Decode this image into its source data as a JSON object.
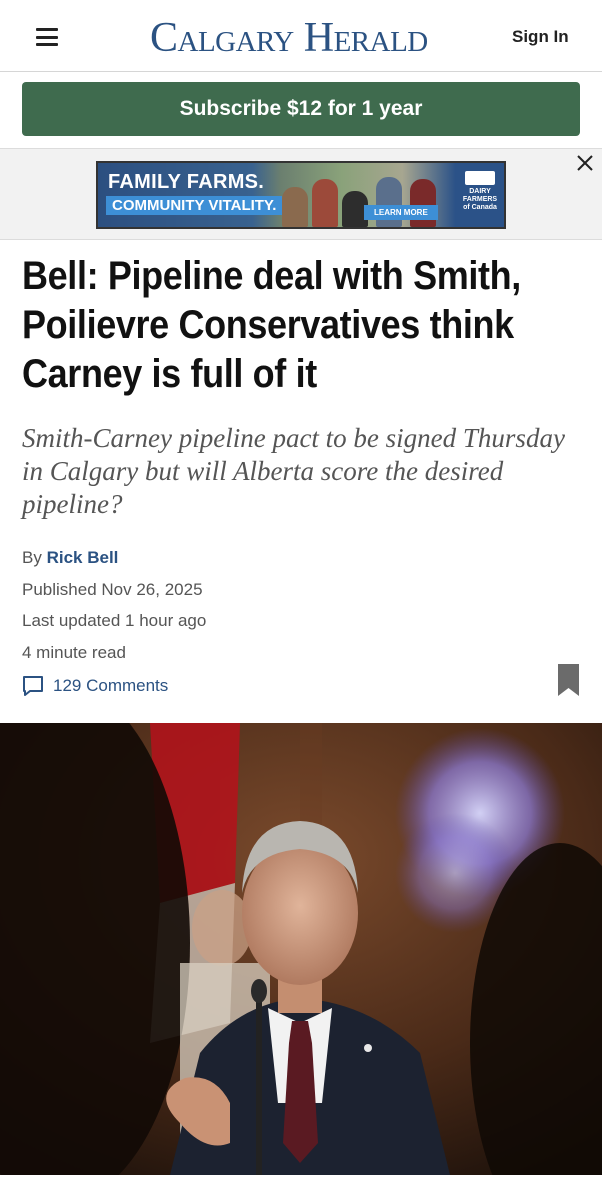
{
  "header": {
    "logo": "Calgary Herald",
    "sign_in": "Sign In",
    "menu_icon": "hamburger-menu-icon"
  },
  "subscribe": {
    "label": "Subscribe $12 for 1 year",
    "color": "#3f6b4e"
  },
  "ad": {
    "line1": "FAMILY FARMS.",
    "line2": "COMMUNITY VITALITY.",
    "cta": "LEARN MORE",
    "logo_text": "DAIRY FARMERS of Canada",
    "close_icon": "close-icon"
  },
  "article": {
    "headline": "Bell: Pipeline deal with Smith, Poilievre Conservatives think Carney is full of it",
    "dek": "Smith-Carney pipeline pact to be signed Thursday in Calgary but will Alberta score the desired pipeline?",
    "by_prefix": "By",
    "author": "Rick Bell",
    "published": "Published Nov 26, 2025",
    "updated": "Last updated 1 hour ago",
    "read_time": "4 minute read",
    "comments": "129 Comments",
    "comment_icon": "comment-icon",
    "bookmark_icon": "bookmark-icon"
  },
  "colors": {
    "brand": "#2b5282",
    "link": "#2b5282",
    "subscribe": "#3f6b4e"
  }
}
